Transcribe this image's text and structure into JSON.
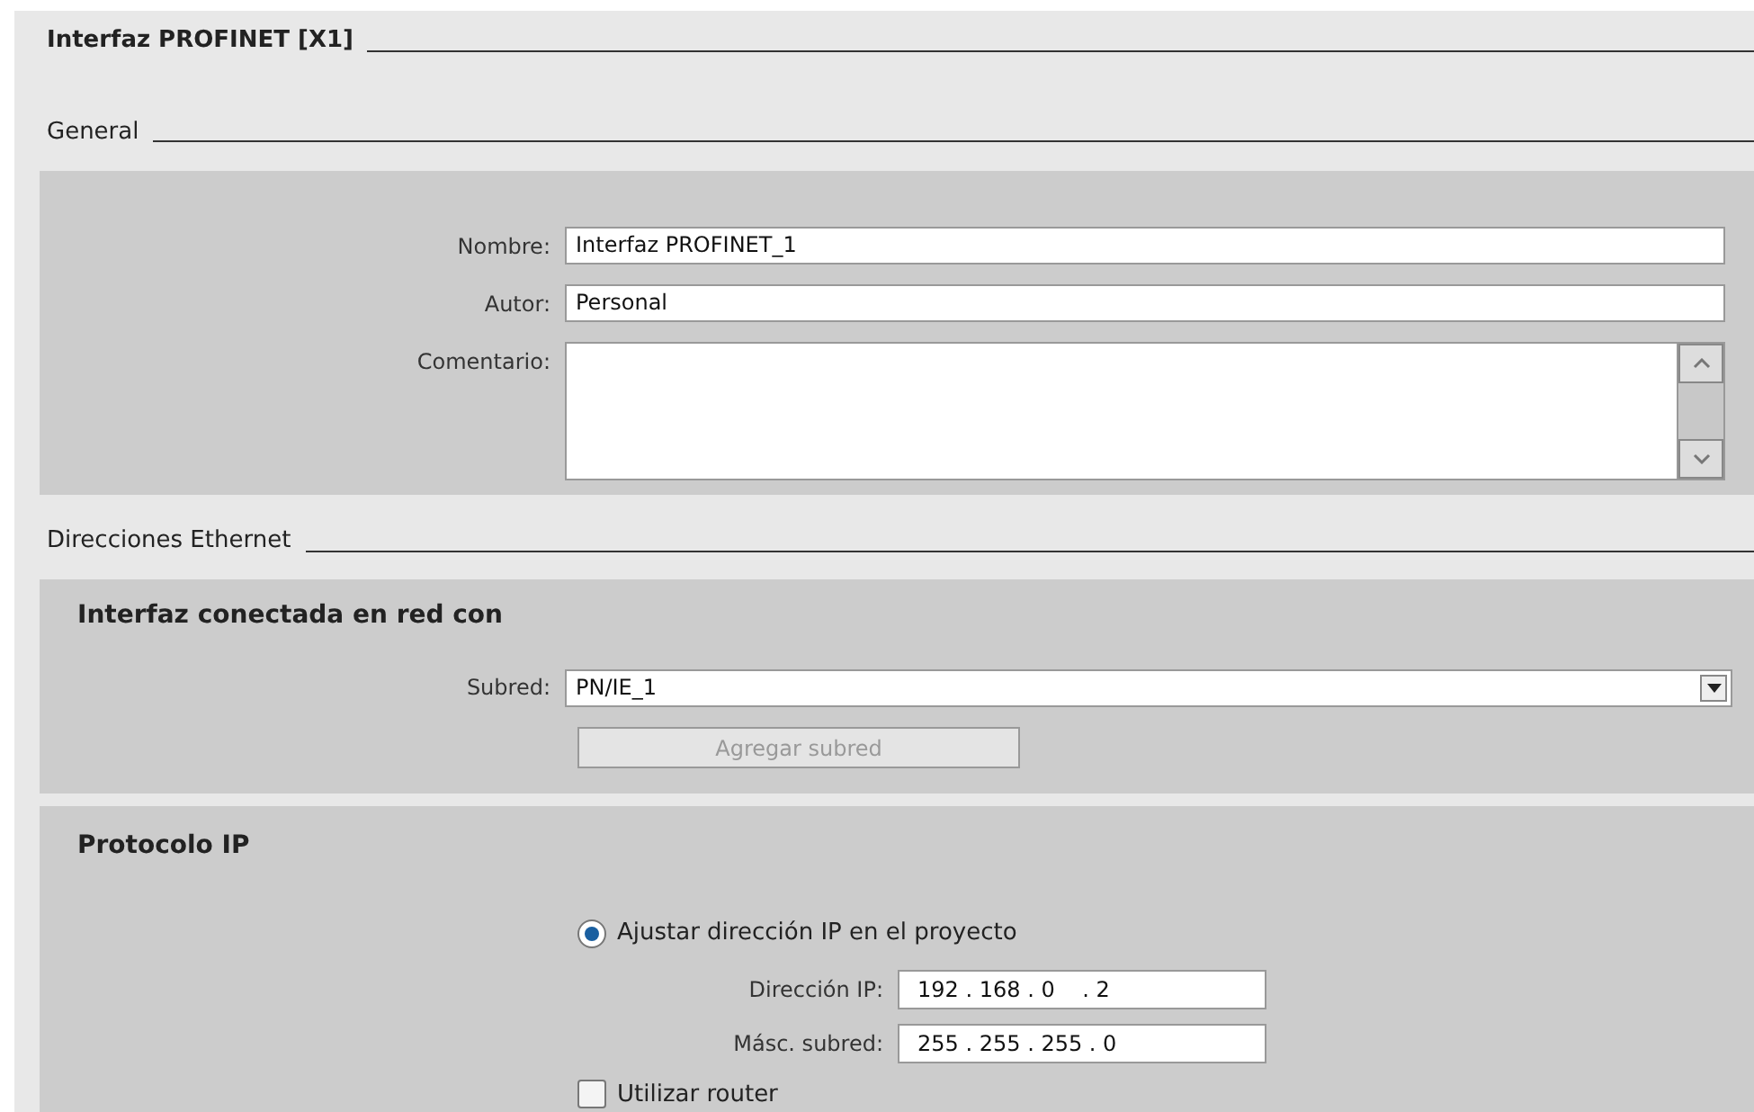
{
  "title": "Interfaz PROFINET [X1]",
  "general": {
    "heading": "General",
    "fields": [
      {
        "label": "Nombre:",
        "value": "Interfaz PROFINET_1",
        "kind": "text"
      },
      {
        "label": "Autor:",
        "value": "Personal",
        "kind": "text"
      },
      {
        "label": "Comentario:",
        "kind": "textarea"
      }
    ]
  },
  "ethernet": {
    "heading": "Direcciones Ethernet",
    "network": {
      "heading": "Interfaz conectada en red con",
      "subnet_label": "Subred:",
      "subnet_value": "PN/IE_1",
      "add_button": {
        "label": "Agregar subred",
        "disabled": true
      }
    },
    "ip": {
      "heading": "Protocolo IP",
      "radio": {
        "label": "Ajustar dirección IP en el proyecto",
        "selected": true
      },
      "fields": [
        {
          "label": "Dirección IP:",
          "value": "192 . 168 . 0    . 2"
        },
        {
          "label": "Másc. subred:",
          "value": "255 . 255 . 255 . 0"
        }
      ],
      "router": {
        "label": "Utilizar router",
        "checked": false
      }
    }
  }
}
